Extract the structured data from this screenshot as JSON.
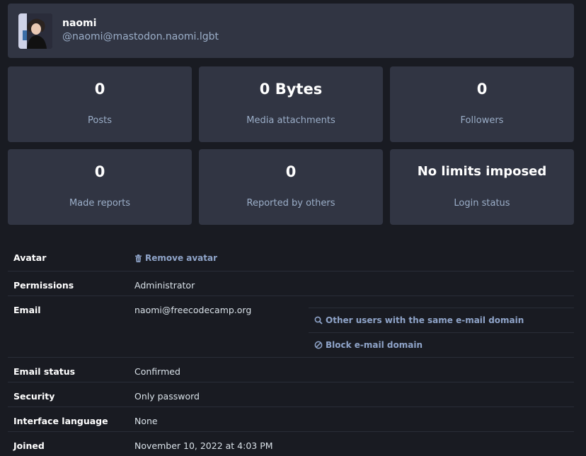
{
  "profile": {
    "display_name": "naomi",
    "handle": "@naomi@mastodon.naomi.lgbt"
  },
  "stats": [
    {
      "value": "0",
      "label": "Posts"
    },
    {
      "value": "0 Bytes",
      "label": "Media attachments"
    },
    {
      "value": "0",
      "label": "Followers"
    },
    {
      "value": "0",
      "label": "Made reports"
    },
    {
      "value": "0",
      "label": "Reported by others"
    },
    {
      "value": "No limits imposed",
      "label": "Login status"
    }
  ],
  "details": {
    "avatar": {
      "key": "Avatar",
      "action": "Remove avatar"
    },
    "permissions": {
      "key": "Permissions",
      "value": "Administrator"
    },
    "email": {
      "key": "Email",
      "value": "naomi@freecodecamp.org",
      "same_domain": "Other users with the same e-mail domain",
      "block_domain": "Block e-mail domain"
    },
    "email_status": {
      "key": "Email status",
      "value": "Confirmed"
    },
    "security": {
      "key": "Security",
      "value": "Only password"
    },
    "language": {
      "key": "Interface language",
      "value": "None"
    },
    "joined": {
      "key": "Joined",
      "value": "November 10, 2022 at 4:03 PM"
    }
  },
  "colors": {
    "background": "#191b22",
    "card": "#313543",
    "label": "#9baec8",
    "link": "#8fa4c9"
  }
}
